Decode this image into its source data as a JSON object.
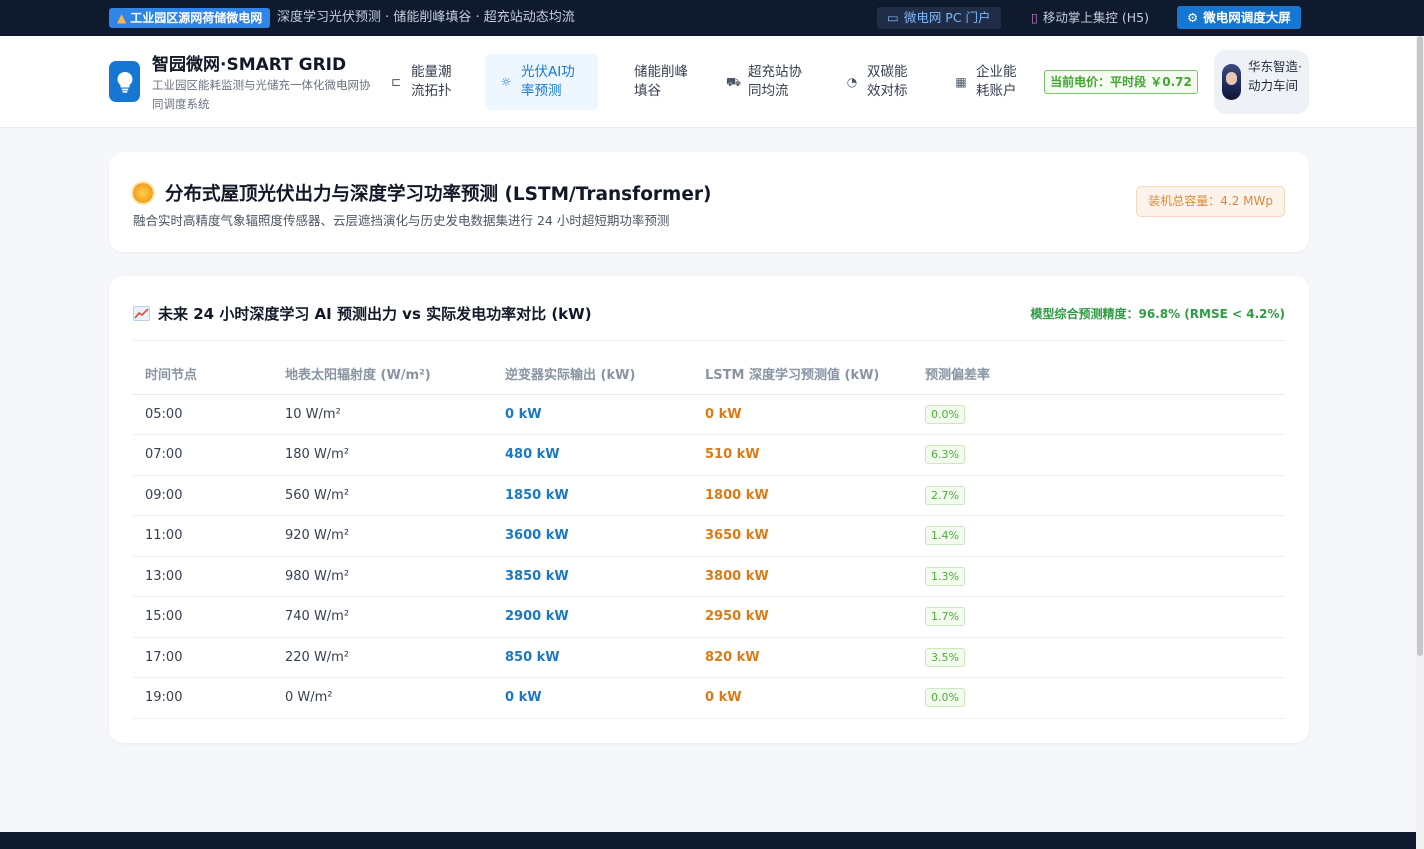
{
  "topbar": {
    "badge": "工业园区源网荷储微电网",
    "tagline": "深度学习光伏预测 · 储能削峰填谷 · 超充站动态均流",
    "link_pc": "微电网 PC 门户",
    "link_h5": "移动掌上集控 (H5)",
    "link_screen": "微电网调度大屏"
  },
  "brand": {
    "title": "智园微网·SMART GRID",
    "subtitle": "工业园区能耗监测与光储充一体化微电网协同调度系统"
  },
  "nav": [
    {
      "label": "能量潮流拓扑",
      "icon": "topology-icon",
      "active": false
    },
    {
      "label": "光伏AI功率预测",
      "icon": "sun-icon",
      "active": true
    },
    {
      "label": "储能削峰填谷",
      "icon": "",
      "active": false
    },
    {
      "label": "超充站协同均流",
      "icon": "truck-icon",
      "active": false
    },
    {
      "label": "双碳能效对标",
      "icon": "pie-icon",
      "active": false
    },
    {
      "label": "企业能耗账户",
      "icon": "building-icon",
      "active": false
    }
  ],
  "price": "当前电价：平时段 ￥0.72",
  "user": {
    "name": "华东智造·动力车间"
  },
  "hero": {
    "title": "分布式屋顶光伏出力与深度学习功率预测 (LSTM/Transformer)",
    "subtitle": "融合实时高精度气象辐照度传感器、云层遮挡演化与历史发电数据集进行 24 小时超短期功率预测",
    "capacity": "装机总容量：4.2 MWp"
  },
  "forecast": {
    "title": "未来 24 小时深度学习 AI 预测出力 vs 实际发电功率对比 (kW)",
    "accuracy": "模型综合预测精度：96.8% (RMSE < 4.2%)",
    "columns": [
      "时间节点",
      "地表太阳辐射度 (W/m²)",
      "逆变器实际输出 (kW)",
      "LSTM 深度学习预测值 (kW)",
      "预测偏差率"
    ],
    "rows": [
      {
        "time": "05:00",
        "irradiance": "10 W/m²",
        "actual": "0 kW",
        "predicted": "0 kW",
        "deviation": "0.0%"
      },
      {
        "time": "07:00",
        "irradiance": "180 W/m²",
        "actual": "480 kW",
        "predicted": "510 kW",
        "deviation": "6.3%"
      },
      {
        "time": "09:00",
        "irradiance": "560 W/m²",
        "actual": "1850 kW",
        "predicted": "1800 kW",
        "deviation": "2.7%"
      },
      {
        "time": "11:00",
        "irradiance": "920 W/m²",
        "actual": "3600 kW",
        "predicted": "3650 kW",
        "deviation": "1.4%"
      },
      {
        "time": "13:00",
        "irradiance": "980 W/m²",
        "actual": "3850 kW",
        "predicted": "3800 kW",
        "deviation": "1.3%"
      },
      {
        "time": "15:00",
        "irradiance": "740 W/m²",
        "actual": "2900 kW",
        "predicted": "2950 kW",
        "deviation": "1.7%"
      },
      {
        "time": "17:00",
        "irradiance": "220 W/m²",
        "actual": "850 kW",
        "predicted": "820 kW",
        "deviation": "3.5%"
      },
      {
        "time": "19:00",
        "irradiance": "0 W/m²",
        "actual": "0 kW",
        "predicted": "0 kW",
        "deviation": "0.0%"
      }
    ]
  },
  "colors": {
    "brand_blue": "#1677d2",
    "actual_blue": "#1b78c4",
    "predicted_orange": "#db7a16",
    "accuracy_green": "#2f9c44",
    "topbar_dark": "#0f1a2e"
  }
}
